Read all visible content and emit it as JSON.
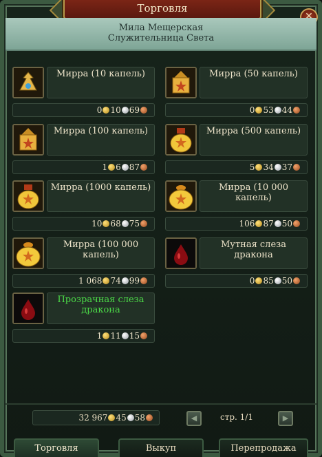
{
  "window": {
    "title": "Торговля",
    "close_glyph": "✕"
  },
  "npc": {
    "name": "Мила Мещерская",
    "role": "Служительница Света"
  },
  "items": [
    {
      "name": "Мирра (10 капель)",
      "icon": "small-bottle-icon",
      "gold": "0",
      "silver": "10",
      "copper": "69",
      "highlight": false
    },
    {
      "name": "Мирра (50 капель)",
      "icon": "golden-lantern-icon",
      "gold": "0",
      "silver": "53",
      "copper": "44",
      "highlight": false
    },
    {
      "name": "Мирра (100 капель)",
      "icon": "golden-lantern-icon",
      "gold": "1",
      "silver": "6",
      "copper": "87",
      "highlight": false
    },
    {
      "name": "Мирра (500 капель)",
      "icon": "golden-flask-icon",
      "gold": "5",
      "silver": "34",
      "copper": "37",
      "highlight": false
    },
    {
      "name": "Мирра (1000 капель)",
      "icon": "golden-flask-icon",
      "gold": "10",
      "silver": "68",
      "copper": "75",
      "highlight": false
    },
    {
      "name": "Мирра (10 000 капель)",
      "icon": "golden-urn-icon",
      "gold": "106",
      "silver": "87",
      "copper": "50",
      "highlight": false
    },
    {
      "name": "Мирра (100 000 капель)",
      "icon": "golden-urn-icon",
      "gold": "1 068",
      "silver": "74",
      "copper": "99",
      "highlight": false
    },
    {
      "name": "Мутная слеза дракона",
      "icon": "dragon-tear-icon",
      "gold": "0",
      "silver": "85",
      "copper": "50",
      "highlight": false
    },
    {
      "name": "Прозрачная слеза дракона",
      "icon": "dragon-tear-icon",
      "gold": "1",
      "silver": "11",
      "copper": "15",
      "highlight": true
    }
  ],
  "money": {
    "gold": "32 967",
    "silver": "45",
    "copper": "58"
  },
  "pagination": {
    "label": "стр. 1/1",
    "prev_glyph": "◀",
    "next_glyph": "▶"
  },
  "tabs": [
    {
      "label": "Торговля",
      "active": true
    },
    {
      "label": "Выкуп",
      "active": false
    },
    {
      "label": "Перепродажа",
      "active": false
    }
  ],
  "colors": {
    "title_banner": "#7b2516",
    "header_bg": "#a9c8bc",
    "highlight_text": "#4cdc48",
    "gold_coin": "#e0b43a",
    "silver_coin": "#d6d9dc",
    "copper_coin": "#c8703a"
  }
}
